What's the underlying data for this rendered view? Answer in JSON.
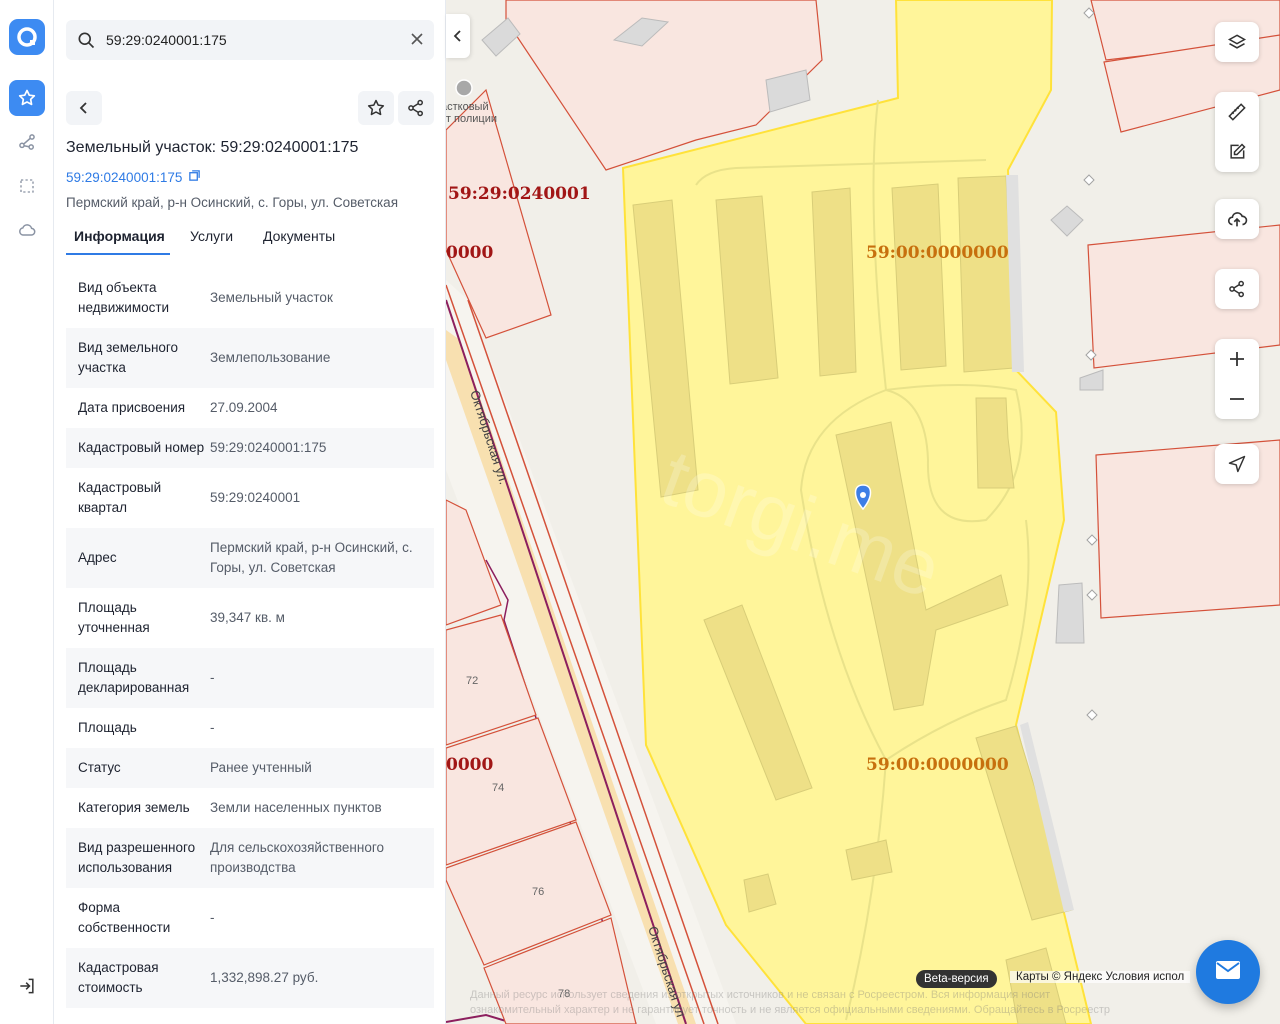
{
  "search": {
    "value": "59:29:0240001:175"
  },
  "panel": {
    "title": "Земельный участок: 59:29:0240001:175",
    "cadastral_link": "59:29:0240001:175",
    "address": "Пермский край, р-н Осинский, с. Горы, ул. Советская",
    "tabs": [
      {
        "label": "Информация"
      },
      {
        "label": "Услуги"
      },
      {
        "label": "Документы"
      }
    ],
    "rows": [
      {
        "key": "Вид объекта недвижимости",
        "value": "Земельный участок"
      },
      {
        "key": "Вид земельного участка",
        "value": "Землепользование"
      },
      {
        "key": "Дата присвоения",
        "value": "27.09.2004"
      },
      {
        "key": "Кадастровый номер",
        "value": "59:29:0240001:175"
      },
      {
        "key": "Кадастровый квартал",
        "value": "59:29:0240001"
      },
      {
        "key": "Адрес",
        "value": "Пермский край, р-н Осинский, с. Горы, ул. Советская"
      },
      {
        "key": "Площадь уточненная",
        "value": "39,347 кв. м"
      },
      {
        "key": "Площадь декларированная",
        "value": "-"
      },
      {
        "key": "Площадь",
        "value": "-"
      },
      {
        "key": "Статус",
        "value": "Ранее учтенный"
      },
      {
        "key": "Категория земель",
        "value": "Земли населенных пунктов"
      },
      {
        "key": "Вид разрешенного использования",
        "value": "Для сельскохозяйственного производства"
      },
      {
        "key": "Форма собственности",
        "value": "-"
      },
      {
        "key": "Кадастровая стоимость",
        "value": "1,332,898.27 руб."
      }
    ]
  },
  "map": {
    "labels": {
      "quarter": "59:29:0240001",
      "zone_top": "59:00:0000000",
      "zone_bottom": "59:00:0000000",
      "edge_top": "0000",
      "edge_bottom": "0000",
      "street1": "Октябрьская ул.",
      "street2": "Октябрьская ул",
      "police": "Участковый пункт полиции",
      "police_visible_1": "астковый",
      "police_visible_2": "кт полиции",
      "house_72": "72",
      "house_74": "74",
      "house_76": "76",
      "house_78": "78",
      "watermark": "torgi.me"
    },
    "beta": "Beta-версия",
    "copyright": "Карты © Яндекс   Условия испол",
    "disclaimer_1": "Данный ресурс использует сведения из открытых источников и не связан с Росреестром. Вся информация носит",
    "disclaimer_2": "ознакомительный характер и не гарантирует точность и не является официальными сведениями. Обращайтесь в Росреестр"
  },
  "colors": {
    "accent": "#3d8bf2",
    "parcel_fill": "#fff59a",
    "parcel_border": "#ffe23a",
    "neighbor_fill": "#f9e6e0",
    "neighbor_border": "#d4513a",
    "label_red": "#a11616",
    "label_orange": "#c7700e"
  }
}
